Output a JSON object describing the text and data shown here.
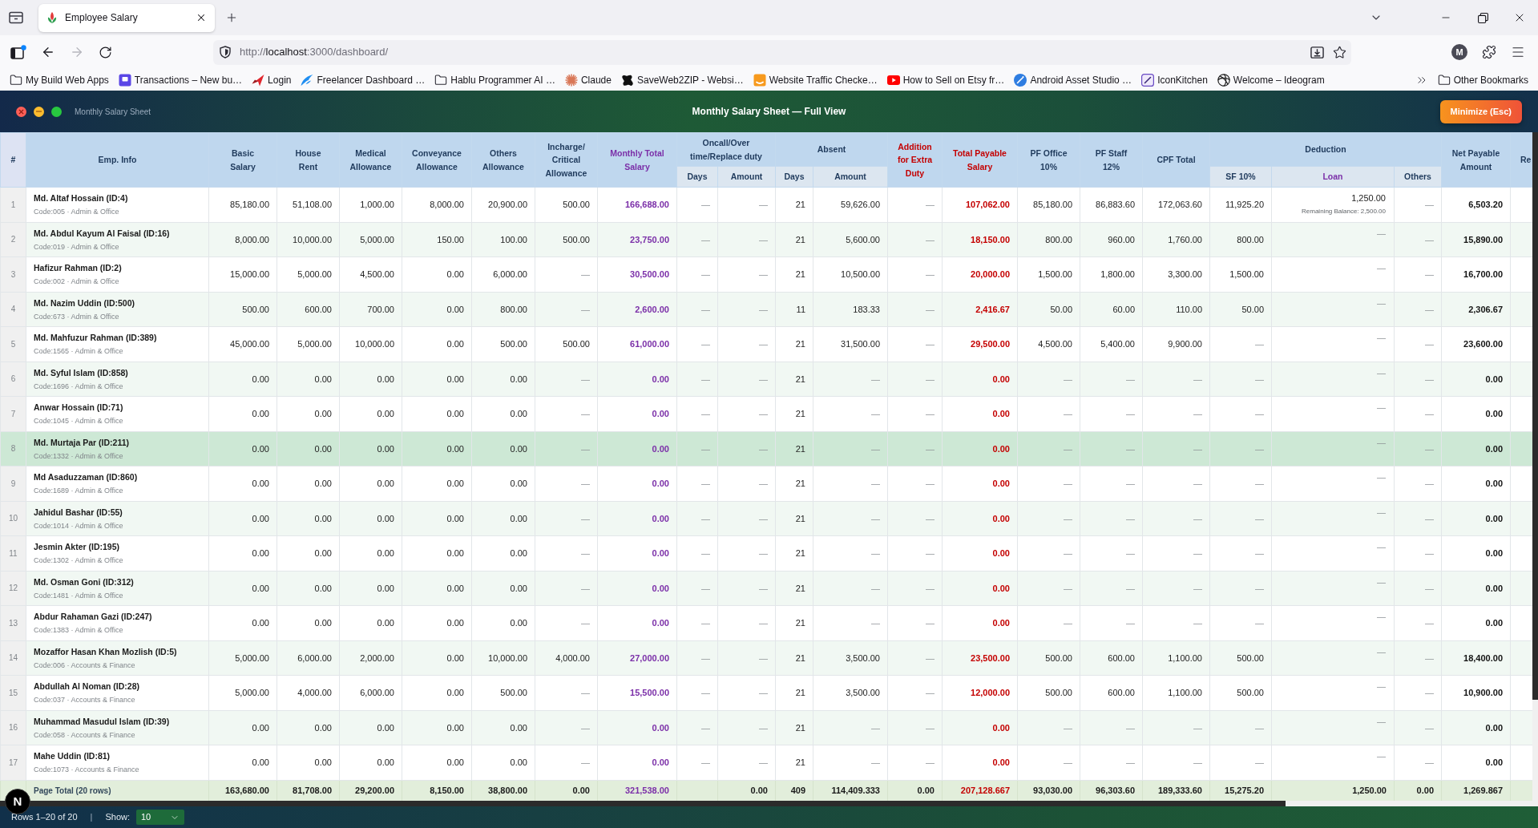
{
  "browser": {
    "tab": {
      "title": "Employee Salary",
      "selected": true
    },
    "forward_disabled": true,
    "url": {
      "scheme": "http://",
      "host": "localhost",
      "path": ":3000/dashboard/"
    },
    "account_initial": "M",
    "bookmarks": [
      {
        "kind": "folder",
        "label": "My Build Web Apps"
      },
      {
        "kind": "site",
        "label": "Transactions – New bu…"
      },
      {
        "kind": "site",
        "label": "Login"
      },
      {
        "kind": "site",
        "label": "Freelancer Dashboard …"
      },
      {
        "kind": "folder",
        "label": "Hablu Programmer AI …"
      },
      {
        "kind": "site",
        "label": "Claude"
      },
      {
        "kind": "site",
        "label": "SaveWeb2ZIP - Websi…"
      },
      {
        "kind": "site",
        "label": "Website Traffic Checke…"
      },
      {
        "kind": "site",
        "label": "How to Sell on Etsy fr…"
      },
      {
        "kind": "site",
        "label": "Android Asset Studio …"
      },
      {
        "kind": "site",
        "label": "IconKitchen"
      },
      {
        "kind": "site",
        "label": "Welcome – Ideogram"
      }
    ],
    "other_bookmarks": {
      "kind": "folder",
      "label": "Other Bookmarks"
    }
  },
  "app": {
    "window_label": "Monthly Salary Sheet",
    "title": "Monthly Salary Sheet — Full View",
    "minimize_button": "Minimize (Esc)"
  },
  "table": {
    "number_heading": "#",
    "employee_heading": "Emp. Info",
    "columns": [
      {
        "kind": "amount",
        "label": "Basic\nSalary"
      },
      {
        "kind": "amount",
        "label": "House\nRent"
      },
      {
        "kind": "amount",
        "label": "Medical\nAllowance"
      },
      {
        "kind": "amount",
        "label": "Conveyance\nAllowance"
      },
      {
        "kind": "amount",
        "label": "Others\nAllowance"
      },
      {
        "kind": "amount",
        "label": "Incharge/\nCritical\nAllowance"
      },
      {
        "kind": "total",
        "label": "Monthly Total\nSalary"
      },
      {
        "kind": "group",
        "label": "Oncall/Over\ntime/Replace duty",
        "colspan": 2,
        "sub": [
          {
            "kind": "amount",
            "label": "Days"
          },
          {
            "kind": "amount",
            "label": "Amount"
          }
        ]
      },
      {
        "kind": "group",
        "label": "Absent",
        "colspan": 2,
        "sub": [
          {
            "kind": "amount",
            "label": "Days"
          },
          {
            "kind": "amount",
            "label": "Amount"
          }
        ]
      },
      {
        "kind": "addition",
        "label": "Addition\nfor Extra\nDuty"
      },
      {
        "kind": "payable",
        "label": "Total Payable\nSalary"
      },
      {
        "kind": "amount",
        "label": "PF Office\n10%"
      },
      {
        "kind": "amount",
        "label": "PF Staff\n12%"
      },
      {
        "kind": "amount",
        "label": "CPF Total"
      },
      {
        "kind": "group",
        "label": "Deduction",
        "colspan": 3,
        "sub": [
          {
            "kind": "amount",
            "label": "SF 10%"
          },
          {
            "kind": "loan",
            "label": "Loan"
          },
          {
            "kind": "amount",
            "label": "Others"
          }
        ]
      },
      {
        "kind": "net",
        "label": "Net Payable\nAmount"
      },
      {
        "kind": "cut",
        "label": "Re"
      }
    ],
    "rows": [
      {
        "number": "1",
        "name": "Md. Altaf Hossain (ID:4)",
        "code": "Code:005 · Admin & Office",
        "selected": false,
        "cells": [
          "85,180.00",
          "51,108.00",
          "1,000.00",
          "8,000.00",
          "20,900.00",
          "500.00",
          "166,688.00",
          "—",
          "—",
          "21",
          "59,626.00",
          "—",
          "107,062.00",
          "85,180.00",
          "86,883.60",
          "172,063.60",
          "11,925.20",
          "1,250.00",
          "—",
          "6,503.20"
        ],
        "loan_note": "Remaining Balance: 2,500.00"
      },
      {
        "number": "2",
        "name": "Md. Abdul Kayum Al Faisal (ID:16)",
        "code": "Code:019 · Admin & Office",
        "selected": false,
        "cells": [
          "8,000.00",
          "10,000.00",
          "5,000.00",
          "150.00",
          "100.00",
          "500.00",
          "23,750.00",
          "—",
          "—",
          "21",
          "5,600.00",
          "—",
          "18,150.00",
          "800.00",
          "960.00",
          "1,760.00",
          "800.00",
          "—",
          "—",
          "15,890.00"
        ]
      },
      {
        "number": "3",
        "name": "Hafizur Rahman (ID:2)",
        "code": "Code:002 · Admin & Office",
        "selected": false,
        "cells": [
          "15,000.00",
          "5,000.00",
          "4,500.00",
          "0.00",
          "6,000.00",
          "—",
          "30,500.00",
          "—",
          "—",
          "21",
          "10,500.00",
          "—",
          "20,000.00",
          "1,500.00",
          "1,800.00",
          "3,300.00",
          "1,500.00",
          "—",
          "—",
          "16,700.00"
        ]
      },
      {
        "number": "4",
        "name": "Md. Nazim Uddin (ID:500)",
        "code": "Code:673 · Admin & Office",
        "selected": false,
        "cells": [
          "500.00",
          "600.00",
          "700.00",
          "0.00",
          "800.00",
          "—",
          "2,600.00",
          "—",
          "—",
          "11",
          "183.33",
          "—",
          "2,416.67",
          "50.00",
          "60.00",
          "110.00",
          "50.00",
          "—",
          "—",
          "2,306.67"
        ]
      },
      {
        "number": "5",
        "name": "Md. Mahfuzur Rahman (ID:389)",
        "code": "Code:1565 · Admin & Office",
        "selected": false,
        "cells": [
          "45,000.00",
          "5,000.00",
          "10,000.00",
          "0.00",
          "500.00",
          "500.00",
          "61,000.00",
          "—",
          "—",
          "21",
          "31,500.00",
          "—",
          "29,500.00",
          "4,500.00",
          "5,400.00",
          "9,900.00",
          "—",
          "—",
          "—",
          "23,600.00"
        ]
      },
      {
        "number": "6",
        "name": "Md. Syful Islam (ID:858)",
        "code": "Code:1696 · Admin & Office",
        "selected": false,
        "cells": [
          "0.00",
          "0.00",
          "0.00",
          "0.00",
          "0.00",
          "—",
          "0.00",
          "—",
          "—",
          "21",
          "—",
          "—",
          "0.00",
          "—",
          "—",
          "—",
          "—",
          "—",
          "—",
          "0.00"
        ]
      },
      {
        "number": "7",
        "name": "Anwar Hossain (ID:71)",
        "code": "Code:1045 · Admin & Office",
        "selected": false,
        "cells": [
          "0.00",
          "0.00",
          "0.00",
          "0.00",
          "0.00",
          "—",
          "0.00",
          "—",
          "—",
          "21",
          "—",
          "—",
          "0.00",
          "—",
          "—",
          "—",
          "—",
          "—",
          "—",
          "0.00"
        ]
      },
      {
        "number": "8",
        "name": "Md. Murtaja Par (ID:211)",
        "code": "Code:1332 · Admin & Office",
        "selected": true,
        "cells": [
          "0.00",
          "0.00",
          "0.00",
          "0.00",
          "0.00",
          "—",
          "0.00",
          "—",
          "—",
          "21",
          "—",
          "—",
          "0.00",
          "—",
          "—",
          "—",
          "—",
          "—",
          "—",
          "0.00"
        ]
      },
      {
        "number": "9",
        "name": "Md Asaduzzaman (ID:860)",
        "code": "Code:1689 · Admin & Office",
        "selected": false,
        "cells": [
          "0.00",
          "0.00",
          "0.00",
          "0.00",
          "0.00",
          "—",
          "0.00",
          "—",
          "—",
          "21",
          "—",
          "—",
          "0.00",
          "—",
          "—",
          "—",
          "—",
          "—",
          "—",
          "0.00"
        ]
      },
      {
        "number": "10",
        "name": "Jahidul Bashar (ID:55)",
        "code": "Code:1014 · Admin & Office",
        "selected": false,
        "cells": [
          "0.00",
          "0.00",
          "0.00",
          "0.00",
          "0.00",
          "—",
          "0.00",
          "—",
          "—",
          "21",
          "—",
          "—",
          "0.00",
          "—",
          "—",
          "—",
          "—",
          "—",
          "—",
          "0.00"
        ]
      },
      {
        "number": "11",
        "name": "Jesmin Akter (ID:195)",
        "code": "Code:1302 · Admin & Office",
        "selected": false,
        "cells": [
          "0.00",
          "0.00",
          "0.00",
          "0.00",
          "0.00",
          "—",
          "0.00",
          "—",
          "—",
          "21",
          "—",
          "—",
          "0.00",
          "—",
          "—",
          "—",
          "—",
          "—",
          "—",
          "0.00"
        ]
      },
      {
        "number": "12",
        "name": "Md. Osman Goni (ID:312)",
        "code": "Code:1481 · Admin & Office",
        "selected": false,
        "cells": [
          "0.00",
          "0.00",
          "0.00",
          "0.00",
          "0.00",
          "—",
          "0.00",
          "—",
          "—",
          "21",
          "—",
          "—",
          "0.00",
          "—",
          "—",
          "—",
          "—",
          "—",
          "—",
          "0.00"
        ]
      },
      {
        "number": "13",
        "name": "Abdur Rahaman Gazi (ID:247)",
        "code": "Code:1383 · Admin & Office",
        "selected": false,
        "cells": [
          "0.00",
          "0.00",
          "0.00",
          "0.00",
          "0.00",
          "—",
          "0.00",
          "—",
          "—",
          "21",
          "—",
          "—",
          "0.00",
          "—",
          "—",
          "—",
          "—",
          "—",
          "—",
          "0.00"
        ]
      },
      {
        "number": "14",
        "name": "Mozaffor Hasan Khan Mozlish (ID:5)",
        "code": "Code:006 · Accounts & Finance",
        "selected": false,
        "cells": [
          "5,000.00",
          "6,000.00",
          "2,000.00",
          "0.00",
          "10,000.00",
          "4,000.00",
          "27,000.00",
          "—",
          "—",
          "21",
          "3,500.00",
          "—",
          "23,500.00",
          "500.00",
          "600.00",
          "1,100.00",
          "500.00",
          "—",
          "—",
          "18,400.00"
        ]
      },
      {
        "number": "15",
        "name": "Abdullah Al Noman (ID:28)",
        "code": "Code:037 · Accounts & Finance",
        "selected": false,
        "cells": [
          "5,000.00",
          "4,000.00",
          "6,000.00",
          "0.00",
          "500.00",
          "—",
          "15,500.00",
          "—",
          "—",
          "21",
          "3,500.00",
          "—",
          "12,000.00",
          "500.00",
          "600.00",
          "1,100.00",
          "500.00",
          "—",
          "—",
          "10,900.00"
        ]
      },
      {
        "number": "16",
        "name": "Muhammad Masudul Islam (ID:39)",
        "code": "Code:058 · Accounts & Finance",
        "selected": false,
        "cells": [
          "0.00",
          "0.00",
          "0.00",
          "0.00",
          "0.00",
          "—",
          "0.00",
          "—",
          "—",
          "21",
          "—",
          "—",
          "0.00",
          "—",
          "—",
          "—",
          "—",
          "—",
          "—",
          "0.00"
        ]
      },
      {
        "number": "17",
        "name": "Mahe Uddin (ID:81)",
        "code": "Code:1073 · Accounts & Finance",
        "selected": false,
        "cells": [
          "0.00",
          "0.00",
          "0.00",
          "0.00",
          "0.00",
          "—",
          "0.00",
          "—",
          "—",
          "21",
          "—",
          "—",
          "0.00",
          "—",
          "—",
          "—",
          "—",
          "—",
          "—",
          "0.00"
        ]
      }
    ],
    "total": {
      "label": "Page Total (20 rows)",
      "cells": [
        "163,680.00",
        "81,708.00",
        "29,200.00",
        "8,150.00",
        "38,800.00",
        "0.00",
        "321,538.00",
        null,
        "0.00",
        "409",
        "114,409.333",
        "0.00",
        "207,128.667",
        "93,030.00",
        "96,303.60",
        "189,333.60",
        "15,275.20",
        "1,250.00",
        "0.00",
        "1,269.867"
      ]
    }
  },
  "footer": {
    "rows_info": "Rows 1–20 of 20",
    "separator": "|",
    "show_label": "Show:",
    "page_size": "10"
  },
  "dev_badge": {
    "label": "N"
  }
}
